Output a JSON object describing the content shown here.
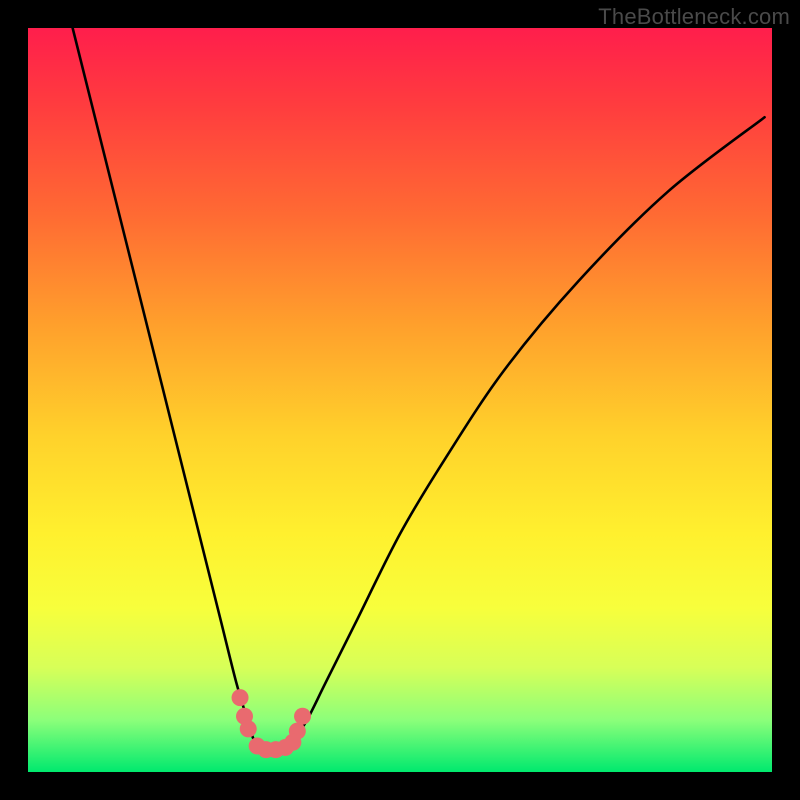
{
  "watermark": "TheBottleneck.com",
  "chart_data": {
    "type": "line",
    "title": "",
    "xlabel": "",
    "ylabel": "",
    "xlim": [
      0,
      100
    ],
    "ylim": [
      0,
      100
    ],
    "series": [
      {
        "name": "bottleneck-curve",
        "x": [
          6,
          10,
          14,
          18,
          22,
          24,
          26,
          28,
          29.5,
          30.5,
          32,
          33.5,
          35.5,
          37.5,
          40,
          44,
          50,
          56,
          64,
          74,
          86,
          99
        ],
        "values": [
          100,
          84,
          68,
          52,
          36,
          28,
          20,
          12,
          7,
          4,
          2.5,
          2.5,
          4,
          7,
          12,
          20,
          32,
          42,
          54,
          66,
          78,
          88
        ]
      }
    ],
    "markers": {
      "name": "trough-markers",
      "color": "#e96a6f",
      "points": [
        {
          "x": 28.5,
          "y": 10
        },
        {
          "x": 29.1,
          "y": 7.5
        },
        {
          "x": 29.6,
          "y": 5.8
        },
        {
          "x": 36.2,
          "y": 5.5
        },
        {
          "x": 36.9,
          "y": 7.5
        },
        {
          "x": 30.8,
          "y": 3.5
        },
        {
          "x": 32.0,
          "y": 3.0
        },
        {
          "x": 33.3,
          "y": 3.0
        },
        {
          "x": 34.6,
          "y": 3.3
        },
        {
          "x": 35.6,
          "y": 4.0
        }
      ]
    }
  }
}
